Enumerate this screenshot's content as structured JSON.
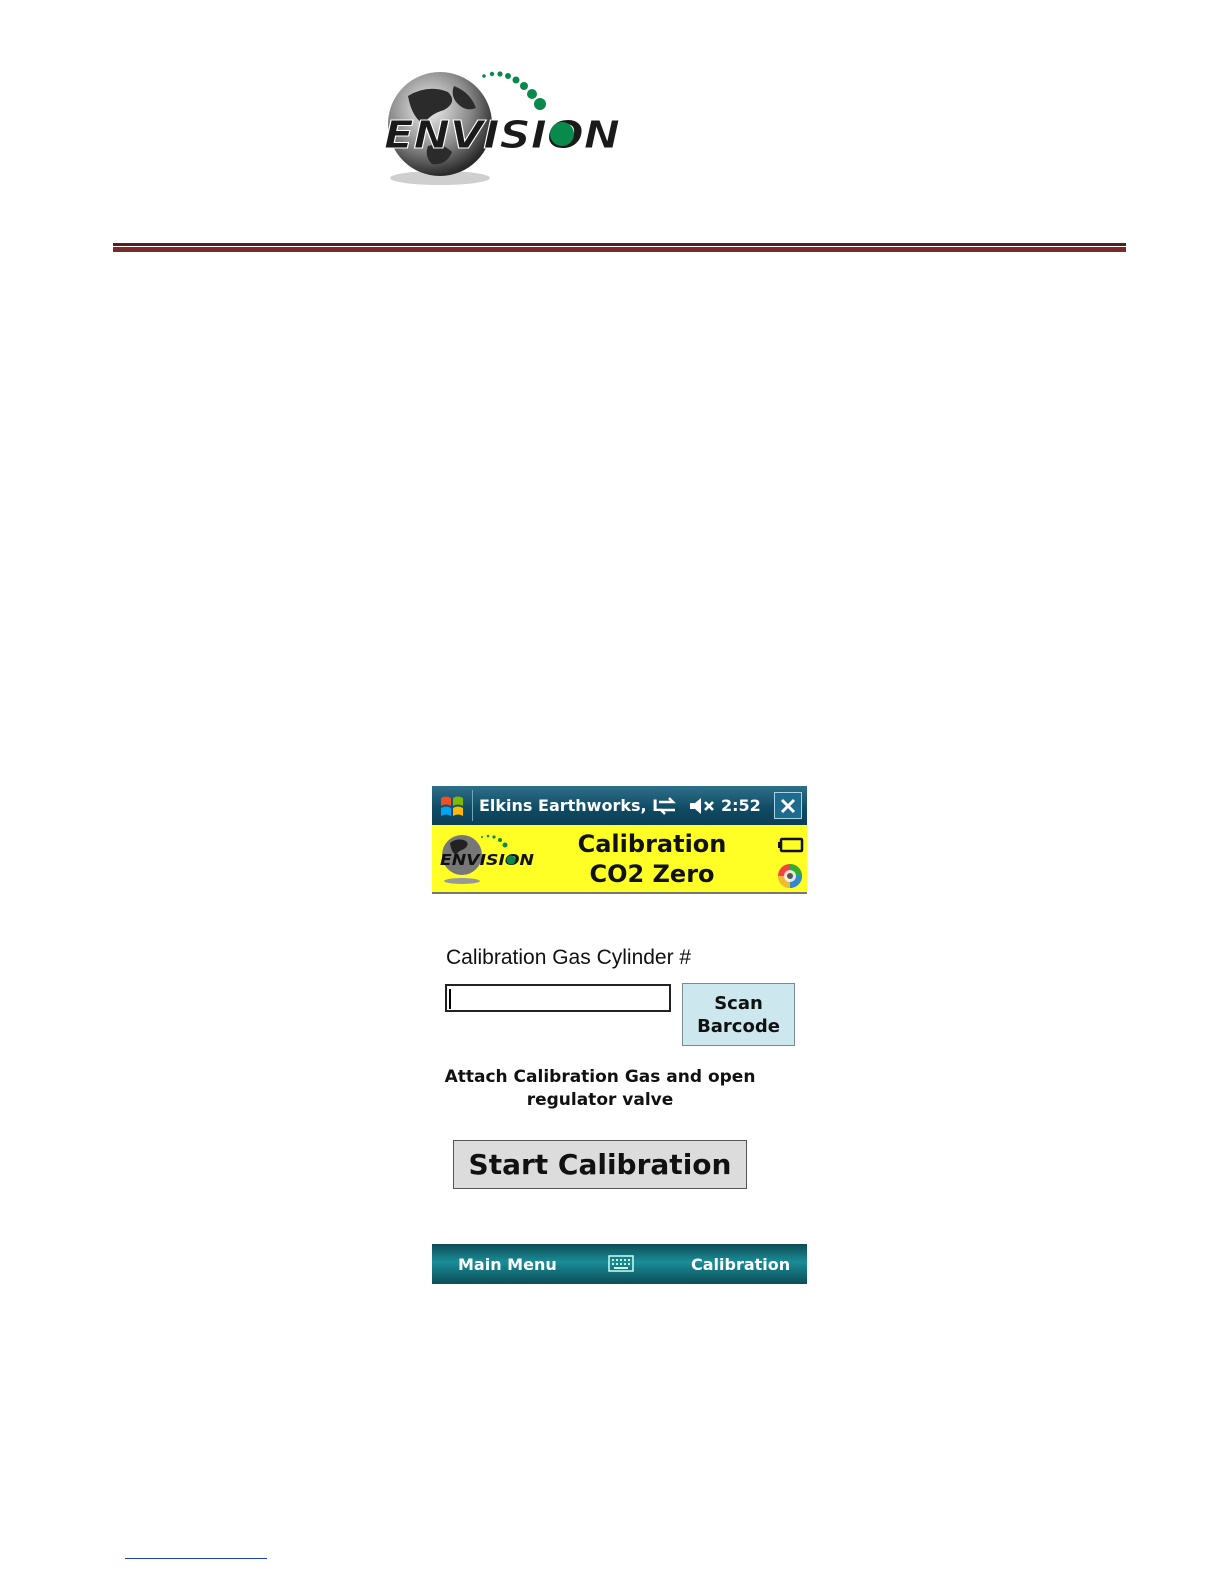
{
  "document": {
    "logo_text": "ENVISION"
  },
  "device": {
    "titlebar": {
      "title": "Elkins Earthworks, L",
      "time": "2:52",
      "icons": [
        "windows-start-icon",
        "connectivity-icon",
        "volume-muted-icon",
        "close-icon"
      ]
    },
    "banner": {
      "logo_text": "ENVISION",
      "title_line1": "Calibration",
      "title_line2": "CO2 Zero",
      "icons": [
        "battery-icon",
        "status-orb-icon"
      ]
    },
    "form": {
      "cylinder_label": "Calibration Gas Cylinder #",
      "cylinder_value": "",
      "scan_button": "Scan\nBarcode",
      "instruction": "Attach Calibration Gas and open regulator valve",
      "start_button": "Start Calibration"
    },
    "softkeys": {
      "left": "Main Menu",
      "right": "Calibration",
      "center_icon": "keyboard-icon"
    }
  },
  "colors": {
    "banner_yellow": "#ffff26",
    "titlebar_teal": "#0f4a63",
    "scan_button_bg": "#cce8ee",
    "start_button_bg": "#dcdcdc",
    "logo_green": "#0a8a4a",
    "rule_maroon": "#6b2020"
  }
}
